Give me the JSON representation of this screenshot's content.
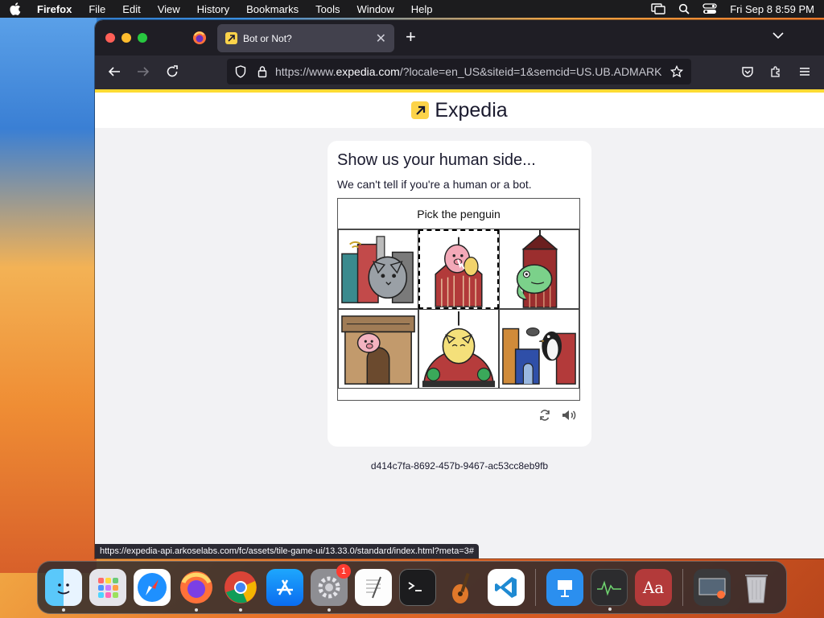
{
  "menubar": {
    "app": "Firefox",
    "items": [
      "File",
      "Edit",
      "View",
      "History",
      "Bookmarks",
      "Tools",
      "Window",
      "Help"
    ],
    "clock": "Fri Sep 8  8:59 PM"
  },
  "browser": {
    "tab_title": "Bot or Not?",
    "url_prefix": "https://www.",
    "url_domain": "expedia.com",
    "url_rest": "/?locale=en_US&siteid=1&semcid=US.UB.ADMARK",
    "status_url": "https://expedia-api.arkoselabs.com/fc/assets/tile-game-ui/13.33.0/standard/index.html?meta=3#"
  },
  "page": {
    "logo_text": "Expedia",
    "heading": "Show us your human side...",
    "subheading": "We can't tell if you're a human or a bot.",
    "instruction": "Pick the penguin",
    "tiles": [
      {
        "name": "tile-1",
        "desc": "cat-in-city"
      },
      {
        "name": "tile-2",
        "desc": "pig-on-church",
        "selected": true
      },
      {
        "name": "tile-3",
        "desc": "chameleon-church"
      },
      {
        "name": "tile-4",
        "desc": "pig-on-arch"
      },
      {
        "name": "tile-5",
        "desc": "cat-on-dome"
      },
      {
        "name": "tile-6",
        "desc": "penguin-in-city"
      }
    ],
    "request_id": "d414c7fa-8692-457b-9467-ac53cc8eb9fb"
  },
  "dock": {
    "apps": [
      "Finder",
      "Launchpad",
      "Safari",
      "Firefox",
      "Chrome",
      "App Store",
      "System Settings",
      "TextEdit",
      "Terminal",
      "GarageBand",
      "VS Code",
      "Keynote",
      "Activity Monitor",
      "Dictionary",
      "Screenshot",
      "Trash"
    ],
    "settings_badge": "1"
  },
  "colors": {
    "accent_yellow": "#fddb32",
    "tab_bg": "#42414d",
    "toolbar_bg": "#2b2a33"
  }
}
